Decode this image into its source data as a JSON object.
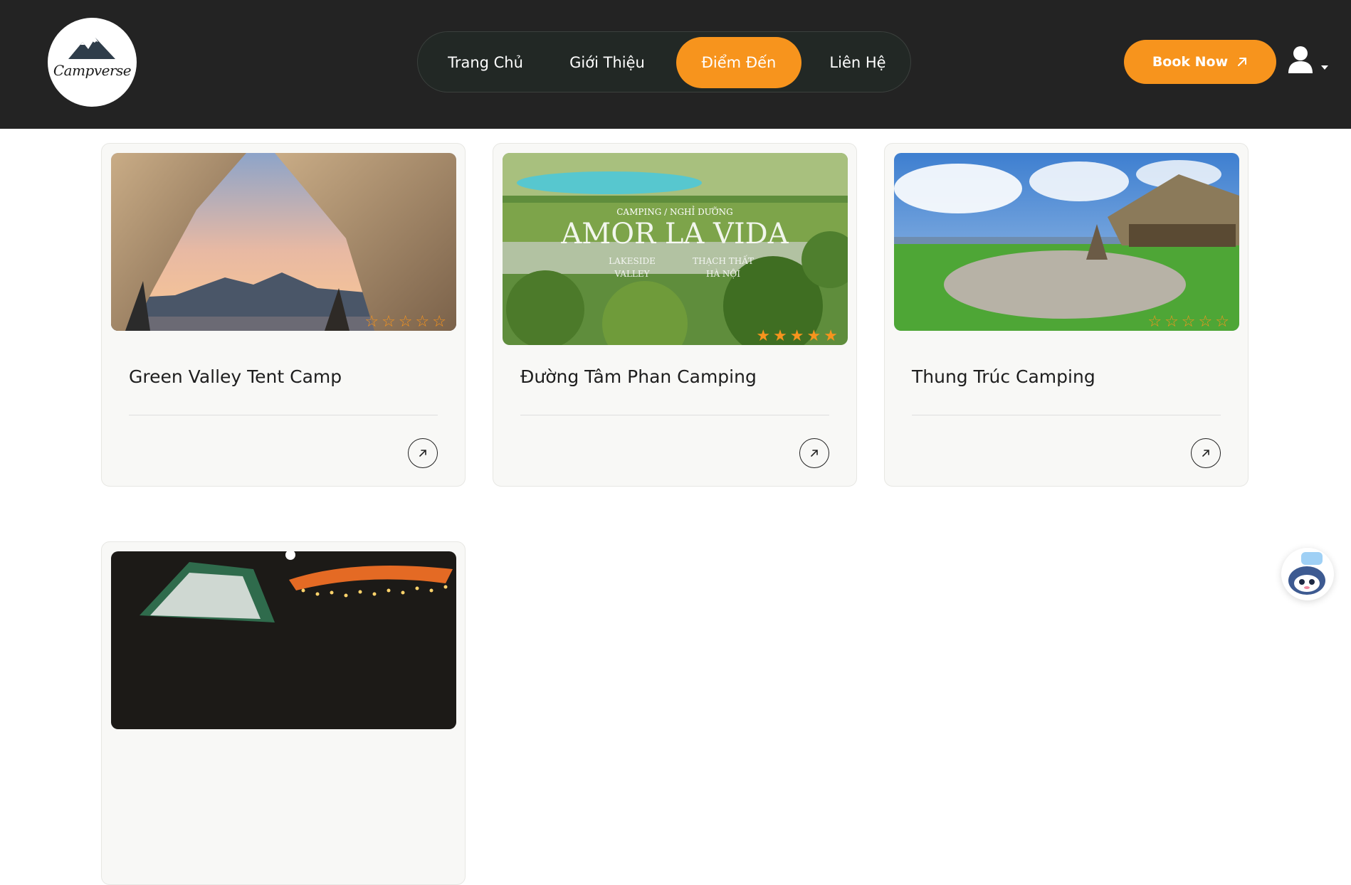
{
  "header": {
    "logo_text": "Campverse",
    "nav": [
      {
        "label": "Trang Chủ",
        "active": false
      },
      {
        "label": "Giới Thiệu",
        "active": false
      },
      {
        "label": "Điểm Đến",
        "active": true
      },
      {
        "label": "Liên Hệ",
        "active": false
      }
    ],
    "book_label": "Book Now",
    "accent_color": "#f7941d",
    "header_bg": "#232323"
  },
  "cards": [
    {
      "title": "Green Valley Tent Camp",
      "rating": 0,
      "image": "tent-sunset-photo"
    },
    {
      "title": "Đường Tâm Phan Camping",
      "rating": 5,
      "image": "amor-la-vida-photo",
      "image_text": {
        "line1": "CAMPING / NGHỈ DƯỠNG",
        "brand": "AMOR LA VIDA",
        "left": [
          "LAKESIDE",
          "VALLEY"
        ],
        "right": [
          "THẠCH THẤT",
          "HÀ NỘI"
        ]
      }
    },
    {
      "title": "Thung Trúc Camping",
      "rating": 0,
      "image": "campsite-meadow-photo"
    },
    {
      "title": "",
      "rating": 0,
      "image": "night-tent-lights-photo"
    }
  ],
  "icons": {
    "arrow": "arrow-up-right-icon",
    "user": "user-icon",
    "chat": "chatbot-icon",
    "star": "star-icon"
  }
}
